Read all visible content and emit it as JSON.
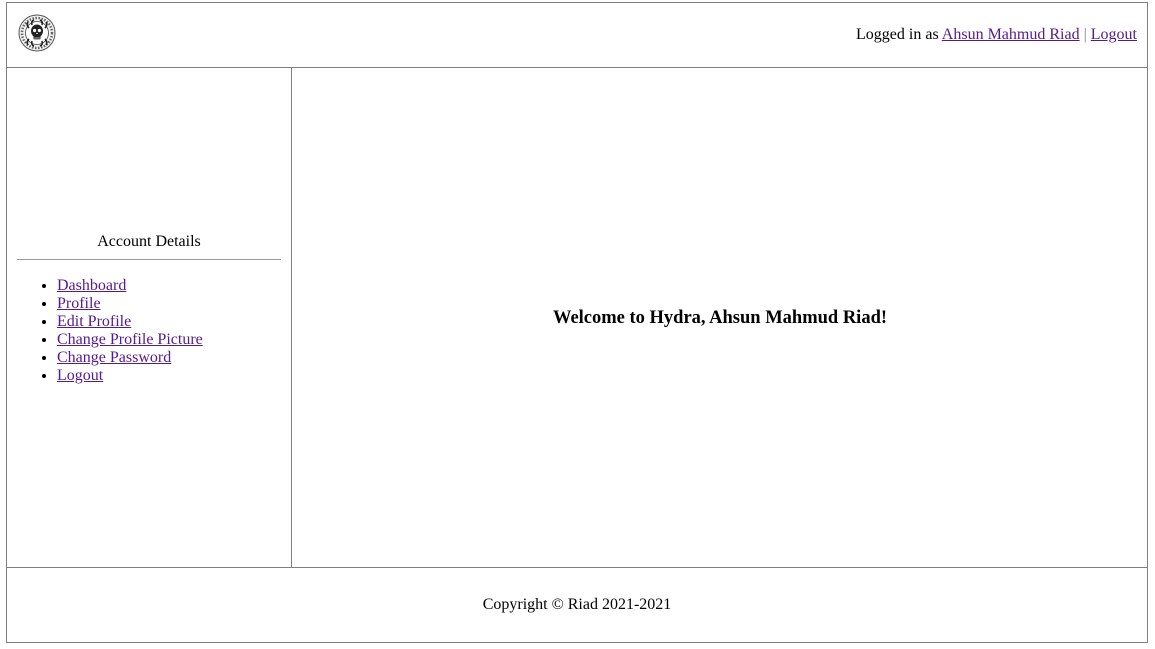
{
  "header": {
    "logo_icon": "hydra-skull-logo-icon",
    "logged_in_prefix": "Logged in as",
    "user_name": "Ahsun Mahmud Riad",
    "separator": "|",
    "logout_label": "Logout"
  },
  "sidebar": {
    "heading": "Account Details",
    "items": [
      {
        "label": "Dashboard"
      },
      {
        "label": "Profile"
      },
      {
        "label": "Edit Profile"
      },
      {
        "label": "Change Profile Picture"
      },
      {
        "label": "Change Password"
      },
      {
        "label": "Logout"
      }
    ]
  },
  "main": {
    "welcome": "Welcome to Hydra, Ahsun Mahmud Riad!"
  },
  "footer": {
    "copyright": "Copyright © Riad 2021-2021"
  },
  "colors": {
    "link": "#551a8b",
    "border": "#808080"
  }
}
